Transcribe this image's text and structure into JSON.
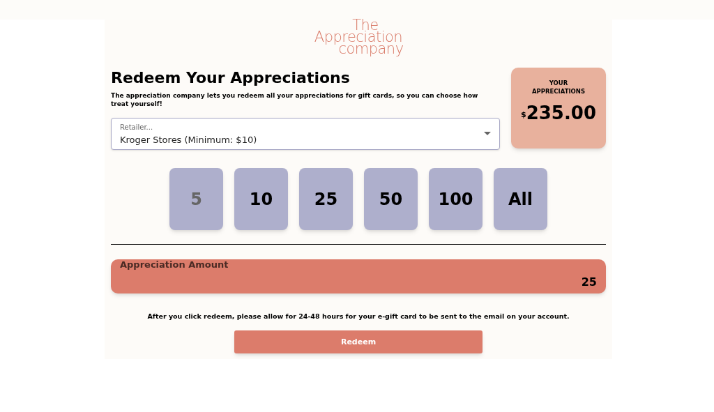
{
  "logo": {
    "lines": [
      "The",
      "Appreciation",
      "company"
    ]
  },
  "heading": "Redeem Your Appreciations",
  "description": "The appreciation company lets you redeem all your appreciations for gift cards, so you can choose how treat yourself!",
  "retailer_select": {
    "label": "Retailer...",
    "value": "Kroger Stores (Minimum: $10)"
  },
  "balance": {
    "label": "YOUR APPRECIATIONS",
    "currency": "$",
    "amount": "235.00"
  },
  "amounts": [
    {
      "label": "5",
      "disabled": true
    },
    {
      "label": "10",
      "disabled": false
    },
    {
      "label": "25",
      "disabled": false
    },
    {
      "label": "50",
      "disabled": false
    },
    {
      "label": "100",
      "disabled": false
    },
    {
      "label": "All",
      "disabled": false
    }
  ],
  "amount_field": {
    "label": "Appreciation Amount",
    "value": "25"
  },
  "notice": "After you click redeem, please allow for 24-48 hours for your e-gift card to be sent to the email on your account.",
  "redeem_button": "Redeem"
}
